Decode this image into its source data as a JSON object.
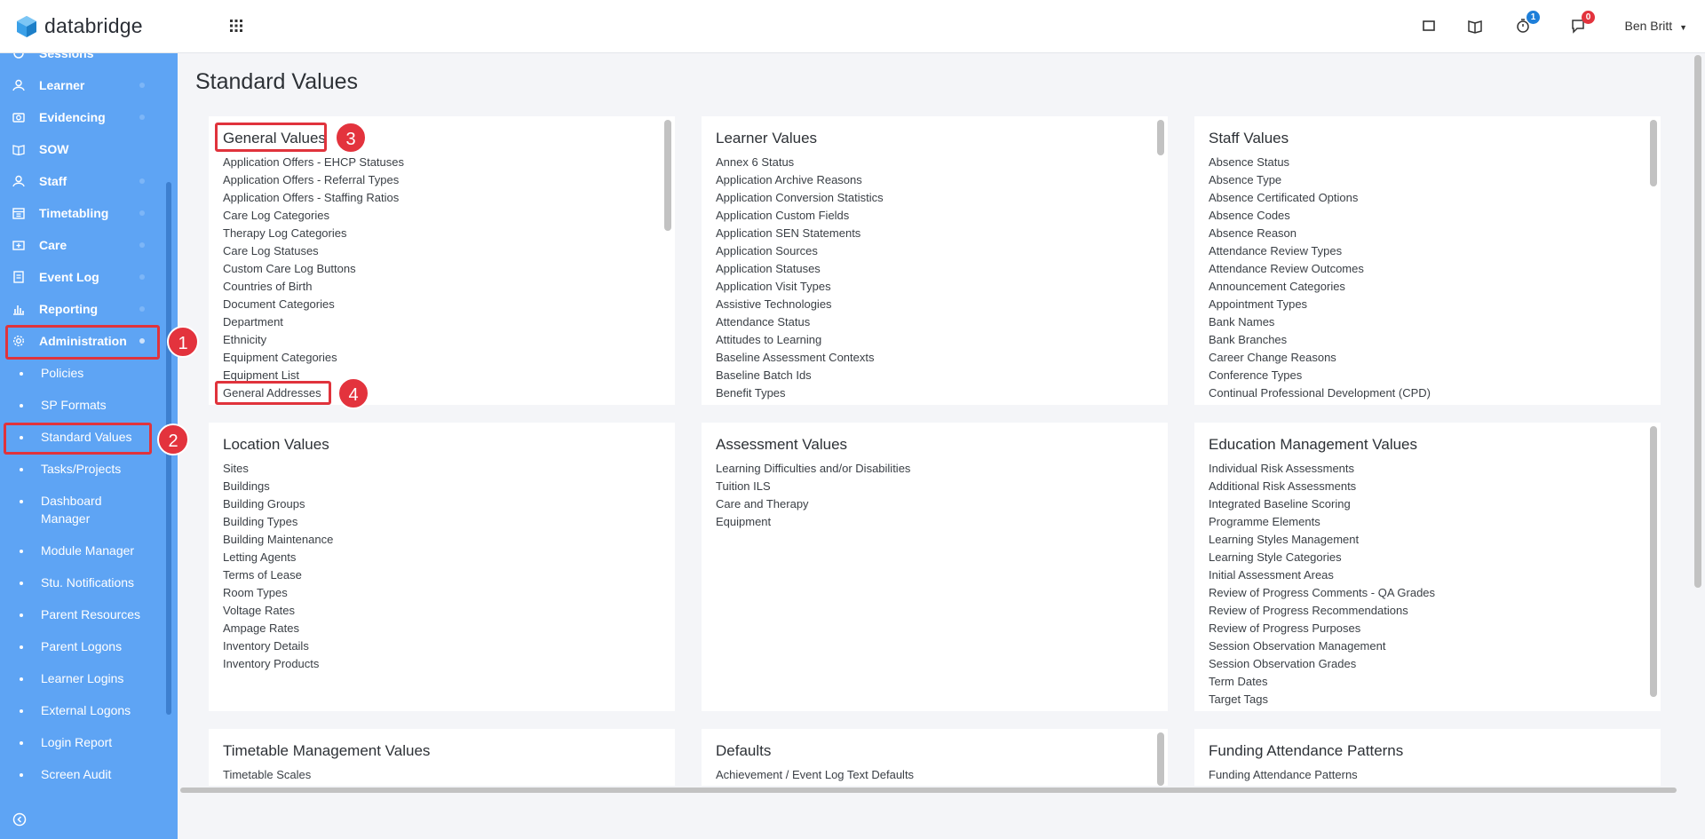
{
  "app": {
    "name": "databridge"
  },
  "topbar": {
    "icons": [
      "window-icon",
      "book-icon",
      "timer-icon",
      "chat-icon"
    ],
    "timer_badge": "1",
    "chat_badge": "0",
    "user": "Ben Britt"
  },
  "sidebar": {
    "items": [
      {
        "label": "Sessions",
        "icon": "sessions-icon"
      },
      {
        "label": "Learner",
        "icon": "learner-icon"
      },
      {
        "label": "Evidencing",
        "icon": "camera-icon"
      },
      {
        "label": "SOW",
        "icon": "book-icon"
      },
      {
        "label": "Staff",
        "icon": "staff-icon"
      },
      {
        "label": "Timetabling",
        "icon": "calendar-icon"
      },
      {
        "label": "Care",
        "icon": "care-icon"
      },
      {
        "label": "Event Log",
        "icon": "log-icon"
      },
      {
        "label": "Reporting",
        "icon": "chart-icon"
      },
      {
        "label": "Administration",
        "icon": "gear-icon"
      }
    ],
    "sub_items": [
      "Policies",
      "SP Formats",
      "Standard Values",
      "Tasks/Projects",
      "Dashboard Manager",
      "Module Manager",
      "Stu. Notifications",
      "Parent Resources",
      "Parent Logons",
      "Learner Logins",
      "External Logons",
      "Login Report",
      "Screen Audit"
    ]
  },
  "markers": [
    "1",
    "2",
    "3",
    "4"
  ],
  "main": {
    "title": "Standard Values",
    "cards": [
      {
        "title": "General Values",
        "items": [
          "Application Offers - EHCP Statuses",
          "Application Offers - Referral Types",
          "Application Offers - Staffing Ratios",
          "Care Log Categories",
          "Therapy Log Categories",
          "Care Log Statuses",
          "Custom Care Log Buttons",
          "Countries of Birth",
          "Document Categories",
          "Department",
          "Ethnicity",
          "Equipment Categories",
          "Equipment List",
          "General Addresses"
        ]
      },
      {
        "title": "Learner Values",
        "items": [
          "Annex 6 Status",
          "Application Archive Reasons",
          "Application Conversion Statistics",
          "Application Custom Fields",
          "Application SEN Statements",
          "Application Sources",
          "Application Statuses",
          "Application Visit Types",
          "Assistive Technologies",
          "Attendance Status",
          "Attitudes to Learning",
          "Baseline Assessment Contexts",
          "Baseline Batch Ids",
          "Benefit Types"
        ]
      },
      {
        "title": "Staff Values",
        "items": [
          "Absence Status",
          "Absence Type",
          "Absence Certificated Options",
          "Absence Codes",
          "Absence Reason",
          "Attendance Review Types",
          "Attendance Review Outcomes",
          "Announcement Categories",
          "Appointment Types",
          "Bank Names",
          "Bank Branches",
          "Career Change Reasons",
          "Conference Types",
          "Continual Professional Development (CPD)"
        ]
      },
      {
        "title": "Location Values",
        "items": [
          "Sites",
          "Buildings",
          "Building Groups",
          "Building Types",
          "Building Maintenance",
          "Letting Agents",
          "Terms of Lease",
          "Room Types",
          "Voltage Rates",
          "Ampage Rates",
          "Inventory Details",
          "Inventory Products"
        ]
      },
      {
        "title": "Assessment Values",
        "items": [
          "Learning Difficulties and/or Disabilities",
          "Tuition ILS",
          "Care and Therapy",
          "Equipment"
        ]
      },
      {
        "title": "Education Management Values",
        "items": [
          "Individual Risk Assessments",
          "Additional Risk Assessments",
          "Integrated Baseline Scoring",
          "Programme Elements",
          "Learning Styles Management",
          "Learning Style Categories",
          "Initial Assessment Areas",
          "Review of Progress Comments - QA Grades",
          "Review of Progress Recommendations",
          "Review of Progress Purposes",
          "Session Observation Management",
          "Session Observation Grades",
          "Term Dates",
          "Target Tags"
        ]
      },
      {
        "title": "Timetable Management Values",
        "items": [
          "Timetable Scales"
        ]
      },
      {
        "title": "Defaults",
        "items": [
          "Achievement / Event Log Text Defaults"
        ]
      },
      {
        "title": "Funding Attendance Patterns",
        "items": [
          "Funding Attendance Patterns"
        ]
      }
    ]
  },
  "colors": {
    "sidebar": "#5ea4f4",
    "highlight": "#e0333c",
    "badge_blue": "#1e7fd9",
    "badge_red": "#e3333d"
  }
}
